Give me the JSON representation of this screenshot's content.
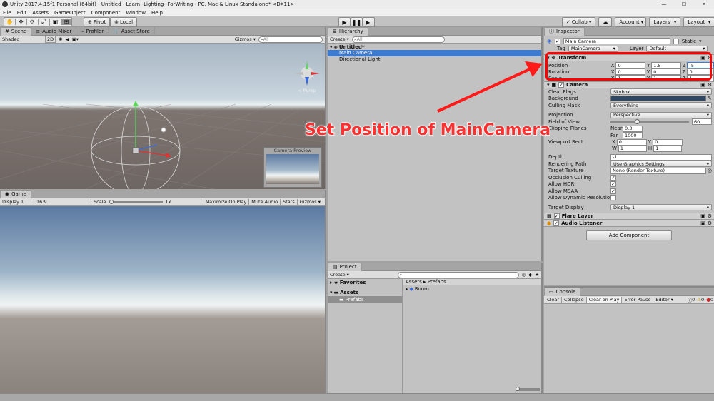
{
  "titlebar": {
    "text": "Unity 2017.4.15f1 Personal (64bit) - Untitled - Learn--Lighting--ForWriting - PC, Mac & Linux Standalone* <DX11>",
    "min": "—",
    "max": "☐",
    "close": "✕"
  },
  "menu": [
    "File",
    "Edit",
    "Assets",
    "GameObject",
    "Component",
    "Window",
    "Help"
  ],
  "toolbar": {
    "pivot": "Pivot",
    "local": "Local",
    "collab": "Collab ▾",
    "account": "Account",
    "layers": "Layers",
    "layout": "Layout"
  },
  "scene": {
    "tabs": [
      "Scene",
      "Audio Mixer",
      "Profiler",
      "Asset Store"
    ],
    "shading": "Shaded",
    "mode2d": "2D",
    "gizmos": "Gizmos ▾",
    "search_placeholder": "All",
    "persp": "< Persp",
    "camera_preview": "Camera Preview"
  },
  "game": {
    "tab": "Game",
    "display": "Display 1",
    "aspect": "16:9",
    "scale_label": "Scale",
    "scale_value": "1x",
    "buttons": [
      "Maximize On Play",
      "Mute Audio",
      "Stats",
      "Gizmos ▾"
    ]
  },
  "hierarchy": {
    "tab": "Hierarchy",
    "create": "Create ▾",
    "search_placeholder": "All",
    "scene_name": "Untitled*",
    "items": [
      "Main Camera",
      "Directional Light"
    ]
  },
  "project": {
    "tab": "Project",
    "create": "Create ▾",
    "favorites": "Favorites",
    "assets": "Assets",
    "prefabs": "Prefabs",
    "breadcrumb": "Assets ▸ Prefabs",
    "items": [
      "Room"
    ]
  },
  "inspector": {
    "tab": "Inspector",
    "object_name": "Main Camera",
    "static_label": "Static",
    "tag_label": "Tag",
    "tag_value": "MainCamera",
    "layer_label": "Layer",
    "layer_value": "Default",
    "transform": {
      "title": "Transform",
      "position_label": "Position",
      "position": {
        "x": "0",
        "y": "1.5",
        "z": "-5"
      },
      "rotation_label": "Rotation",
      "rotation": {
        "x": "0",
        "y": "0",
        "z": "0"
      },
      "scale_label": "Scale",
      "scale": {
        "x": "1",
        "y": "1",
        "z": "1"
      }
    },
    "camera": {
      "title": "Camera",
      "clear_flags_label": "Clear Flags",
      "clear_flags": "Skybox",
      "background_label": "Background",
      "culling_label": "Culling Mask",
      "culling": "Everything",
      "projection_label": "Projection",
      "projection": "Perspective",
      "fov_label": "Field of View",
      "fov": "60",
      "fov_fraction": 0.33,
      "clipping_label": "Clipping Planes",
      "near_label": "Near",
      "near": "0.3",
      "far_label": "Far",
      "far": "1000",
      "viewport_label": "Viewport Rect",
      "vp": {
        "x": "0",
        "y": "0",
        "w": "1",
        "h": "1"
      },
      "depth_label": "Depth",
      "depth": "-1",
      "rendering_path_label": "Rendering Path",
      "rendering_path": "Use Graphics Settings",
      "target_texture_label": "Target Texture",
      "target_texture": "None (Render Texture)",
      "occlusion_label": "Occlusion Culling",
      "hdr_label": "Allow HDR",
      "msaa_label": "Allow MSAA",
      "dynres_label": "Allow Dynamic Resolution",
      "target_display_label": "Target Display",
      "target_display": "Display 1"
    },
    "flare_layer": "Flare Layer",
    "audio_listener": "Audio Listener",
    "add_component": "Add Component"
  },
  "console": {
    "tab": "Console",
    "buttons": [
      "Clear",
      "Collapse",
      "Clear on Play",
      "Error Pause",
      "Editor ▾"
    ],
    "counts": [
      "0",
      "0",
      "0"
    ]
  },
  "annotation": {
    "text": "Set Position of MainCamera",
    "color": "#ff1a1a"
  },
  "colors": {
    "selection": "#3d7bd1",
    "highlight_box": "#ff0000"
  }
}
